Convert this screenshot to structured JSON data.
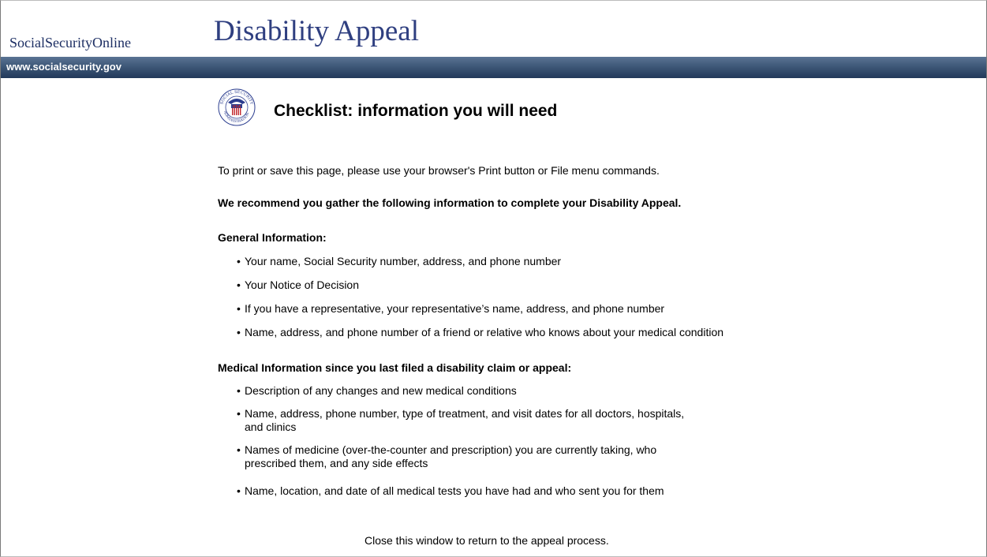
{
  "header": {
    "brand": "SocialSecurityOnline",
    "title": "Disability Appeal",
    "url": "www.socialsecurity.gov"
  },
  "checklist": {
    "title": "Checklist: information you will need",
    "print_note": "To print or save this page, please use your browser's Print button or File menu commands.",
    "recommend": "We recommend you gather the following information to complete your Disability Appeal.",
    "general_heading": "General Information:",
    "general_items": [
      "Your name, Social Security number, address, and phone number",
      "Your Notice of Decision",
      "If you have a representative, your representative’s name, address, and phone number",
      "Name, address, and phone number of a friend or relative who knows about your medical condition"
    ],
    "medical_heading": "Medical Information since you last filed a disability claim or appeal:",
    "medical_items": [
      "Description of any changes and new medical conditions",
      "Name, address, phone number, type of treatment, and visit dates for all doctors, hospitals,",
      "and clinics",
      "Names of medicine (over-the-counter and prescription) you are currently taking, who",
      "prescribed them, and any side effects",
      "Name, location, and date of all medical tests you have had and who sent you for them"
    ],
    "close_note": "Close this window to return to the appeal process."
  },
  "seal": {
    "text_top": "SOCIAL SECURITY",
    "text_bottom": "ADMINISTRATION",
    "text_center": "USA",
    "colors": {
      "blue": "#2b3d8f",
      "red": "#c0262c"
    }
  }
}
